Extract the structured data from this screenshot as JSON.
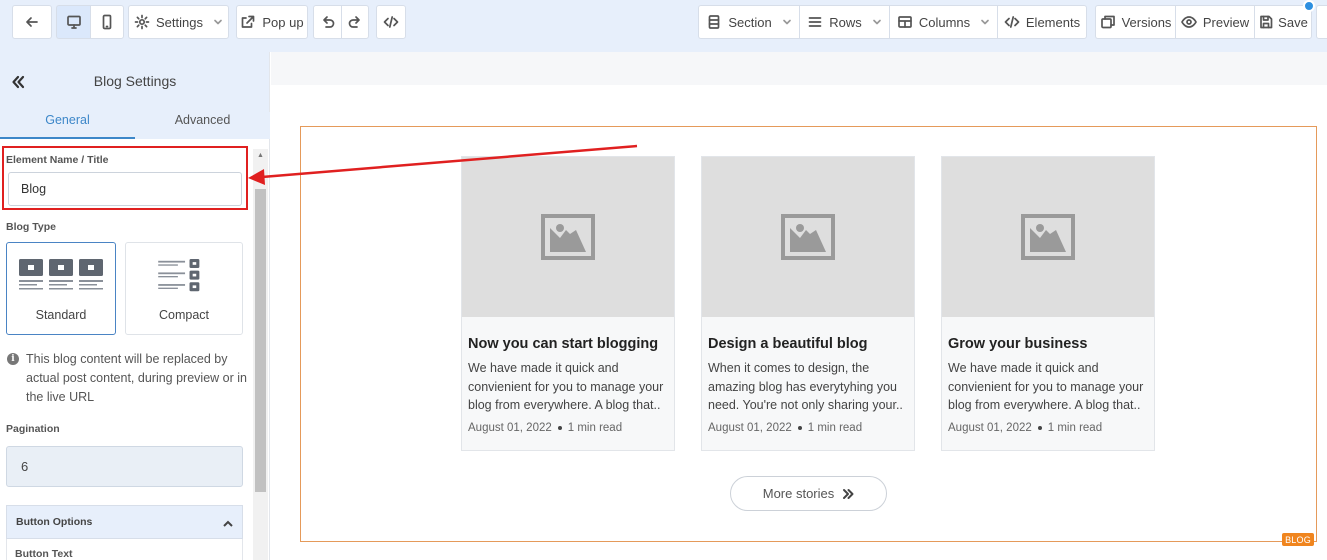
{
  "toolbar": {
    "settings_label": "Settings",
    "popup_label": "Pop up",
    "section_label": "Section",
    "rows_label": "Rows",
    "columns_label": "Columns",
    "elements_label": "Elements",
    "versions_label": "Versions",
    "preview_label": "Preview",
    "save_label": "Save"
  },
  "panel": {
    "title": "Blog Settings",
    "tabs": [
      {
        "label": "General",
        "active": true
      },
      {
        "label": "Advanced",
        "active": false
      }
    ],
    "element_name_label": "Element Name / Title",
    "element_name_value": "Blog",
    "blog_type_label": "Blog Type",
    "blog_types": [
      {
        "label": "Standard",
        "selected": true
      },
      {
        "label": "Compact",
        "selected": false
      }
    ],
    "info_text": "This blog content will be replaced by actual post content, during preview or in the live URL",
    "pagination_label": "Pagination",
    "pagination_value": "6",
    "button_options_label": "Button Options",
    "button_text_label": "Button Text"
  },
  "canvas": {
    "element_tag": "BLOG",
    "posts": [
      {
        "title": "Now you can start blogging",
        "excerpt": "We have made it quick and convienient for you to manage your blog from everywhere. A blog that..",
        "date": "August 01, 2022",
        "read_time": "1 min read"
      },
      {
        "title": "Design a beautiful blog",
        "excerpt": "When it comes to design, the amazing blog has everytyhing you need. You're not only sharing your..",
        "date": "August 01, 2022",
        "read_time": "1 min read"
      },
      {
        "title": "Grow your business",
        "excerpt": "We have made it quick and convienient for you to manage your blog from everywhere. A blog that..",
        "date": "August 01, 2022",
        "read_time": "1 min read"
      }
    ],
    "more_button_label": "More stories"
  },
  "colors": {
    "accent": "#3d87c9",
    "highlight": "#e02020",
    "frame": "#e59a5a",
    "tag": "#f0851e"
  }
}
